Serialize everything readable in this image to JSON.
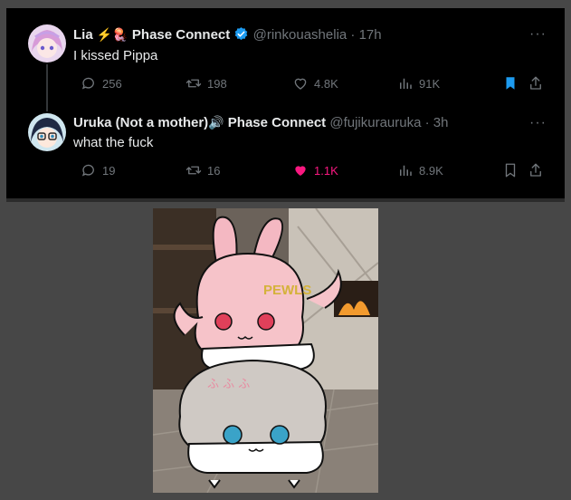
{
  "tweets": [
    {
      "display_name": "Lia",
      "emoji_1": "⚡",
      "emoji_2": "🪼",
      "org": "Phase Connect",
      "handle": "@rinkouashelia",
      "separator": "·",
      "time": "17h",
      "text": "I kissed Pippa",
      "replies": "256",
      "retweets": "198",
      "likes": "4.8K",
      "views": "91K",
      "liked": false,
      "bookmarked": true
    },
    {
      "display_name": "Uruka (Not a mother)",
      "emoji_1": "🔊",
      "org": "Phase Connect",
      "handle": "@fujikurauruka",
      "separator": "·",
      "time": "3h",
      "text": "what the fuck",
      "replies": "19",
      "retweets": "16",
      "likes": "1.1K",
      "views": "8.9K",
      "liked": true,
      "bookmarked": false
    }
  ],
  "more_label": "···",
  "drawing": {
    "headband_text": "PEWLS",
    "hair_text": "ふ ふ ふ"
  },
  "colors": {
    "like_active": "#f91880",
    "bookmark_active": "#1d9bf0",
    "verified": "#1d9bf0",
    "muted": "#71767b"
  },
  "icons": [
    "reply-icon",
    "retweet-icon",
    "like-icon",
    "views-icon",
    "bookmark-icon",
    "share-icon",
    "verified-icon",
    "more-icon"
  ]
}
